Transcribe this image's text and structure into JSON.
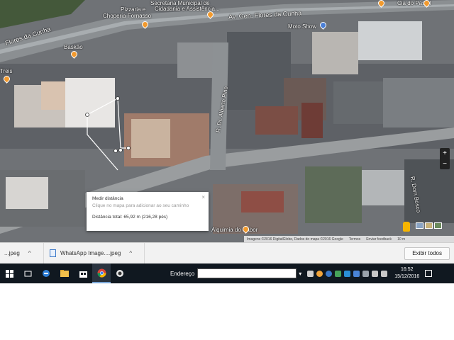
{
  "map": {
    "labels": {
      "avenue": "Av. Gen. Flores da Cunha",
      "avenue_left": "Flores da Cunha",
      "pizzaria": "Pizzaria e",
      "choperia": "Choperia Fornasso",
      "secretaria_1": "Secretaria Municipal de",
      "secretaria_2": "Cidadania e Assistência...",
      "cia_pastel": "Cia do Pastel",
      "baskao": "Baskão",
      "treis": "Treis",
      "moto_show": "Moto Show",
      "alquimia": "Alquimia do Sabor",
      "side_street": "R. Dr. Alberto Pino",
      "right_street": "R. Dom Bosco"
    },
    "attribution": {
      "imagery": "Imagens ©2016 DigitalGlobe, Dados do mapa ©2016 Google",
      "terms": "Termos",
      "feedback": "Enviar feedback",
      "scale": "10 m"
    },
    "measure_popup": {
      "title": "Medir distância",
      "hint": "Clique no mapa para adicionar ao seu caminho",
      "total": "Distância total: 65,92 m (216,28 pés)",
      "close": "×"
    },
    "controls": {
      "zoom_in": "+",
      "zoom_out": "−"
    }
  },
  "downloads": {
    "items": [
      {
        "name": "...jpeg",
        "chevron": "^"
      },
      {
        "name": "WhatsApp Image....jpeg",
        "chevron": "^"
      }
    ],
    "show_all": "Exibir todos"
  },
  "taskbar": {
    "icons": [
      "windows-start-icon",
      "search-icon",
      "task-view-icon",
      "edge-icon",
      "file-explorer-icon",
      "store-icon",
      "chrome-icon",
      "app-icon"
    ],
    "address_label": "Endereço",
    "address_value": "",
    "clock_time": "16:52",
    "clock_date": "15/12/2016"
  },
  "colors": {
    "poi_orange": "#f29a2e",
    "poi_blue": "#4a7fd6",
    "taskbar_bg": "#101820",
    "downloads_bg": "#f2f2f2"
  }
}
